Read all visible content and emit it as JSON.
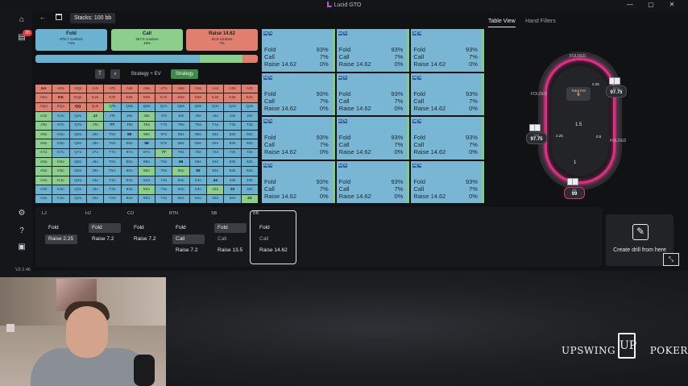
{
  "app": {
    "title": "Lucid GTO",
    "window_controls": [
      "—",
      "▢",
      "✕"
    ],
    "version": "V2.2.46"
  },
  "sidebar": {
    "notifications": "20"
  },
  "toolbar": {
    "stacks": "Stacks: 100 bb",
    "tabs": [
      {
        "label": "Table View",
        "active": true
      },
      {
        "label": "Hand Filters",
        "active": false
      }
    ]
  },
  "strategy": {
    "actions": [
      {
        "name": "Fold",
        "combos": "975.7 combos",
        "pct": "74%",
        "color": "#6bb2d1"
      },
      {
        "name": "Call",
        "combos": "257.5 combos",
        "pct": "19%",
        "color": "#8ccf8c"
      },
      {
        "name": "Raise 14.62",
        "combos": "92.8 combos",
        "pct": "7%",
        "color": "#e07f6e"
      }
    ],
    "freq": {
      "fold": 74,
      "call": 19,
      "raise": 7
    }
  },
  "matrix_controls": {
    "btn_t": "T",
    "btn_search": "⌕",
    "mode_ev": "Strategy + EV",
    "mode_strategy": "Strategy"
  },
  "matrix": {
    "ranks": [
      "A",
      "K",
      "Q",
      "J",
      "T",
      "9",
      "8",
      "7",
      "6",
      "5",
      "4",
      "3",
      "2"
    ]
  },
  "hand_detail": {
    "rows": [
      {
        "combo": "A♠ T♠",
        "fold_label": "Fold",
        "fold": "93%",
        "call_label": "Call",
        "call": "7%",
        "raise_label": "Raise 14.62",
        "raise": "0%"
      }
    ],
    "count": 12
  },
  "table": {
    "pot_label": "Total Pot",
    "pot_value": "6",
    "seats": [
      {
        "pos": "FOLDED",
        "stack": ""
      },
      {
        "pos": "BTN",
        "stack": "97.75",
        "bet": "2.25"
      },
      {
        "pos": "CO",
        "stack": "97.75",
        "bet": "2.25"
      },
      {
        "pos": "SB",
        "stack": "",
        "bet": "0.5"
      },
      {
        "pos": "BB",
        "stack": "99",
        "bet": "1"
      }
    ],
    "labels": {
      "folded_top": "FOLDED",
      "folded_left": "FOLDED",
      "folded_right": "FOLDED",
      "center_chip": "1.5",
      "btn_bet": "2.25",
      "co_bet": "2.25",
      "sb_bet": "0.5",
      "bb_bet": "1",
      "btn_label": "BTN",
      "btn_stack": "97.75",
      "co_label": "CO",
      "co_stack": "97.75",
      "bb_label": "BB",
      "bb_stack": "99"
    }
  },
  "history": {
    "positions": [
      {
        "name": "LJ",
        "actions": [
          {
            "label": "Fold"
          },
          {
            "label": "Raise 2.25",
            "selected": true
          }
        ]
      },
      {
        "name": "HJ",
        "actions": [
          {
            "label": "Fold",
            "selected": true
          },
          {
            "label": "Raise 7.2"
          }
        ]
      },
      {
        "name": "CO",
        "actions": [
          {
            "label": "Fold"
          },
          {
            "label": "Raise 7.2"
          }
        ]
      },
      {
        "name": "BTN",
        "actions": [
          {
            "label": "Fold"
          },
          {
            "label": "Call",
            "selected": true
          },
          {
            "label": "Raise 7.2"
          }
        ]
      },
      {
        "name": "SB",
        "actions": [
          {
            "label": "Fold",
            "selected": true
          },
          {
            "label": "Call"
          },
          {
            "label": "Raise 13.5"
          }
        ]
      },
      {
        "name": "BB",
        "actions": [
          {
            "label": "Fold"
          },
          {
            "label": "Call"
          },
          {
            "label": "Raise 14.62"
          }
        ]
      }
    ],
    "drill": "Create drill from here"
  },
  "branding": {
    "logo_left": "UPSWING",
    "logo_mark": "UP",
    "logo_right": "POKER"
  }
}
